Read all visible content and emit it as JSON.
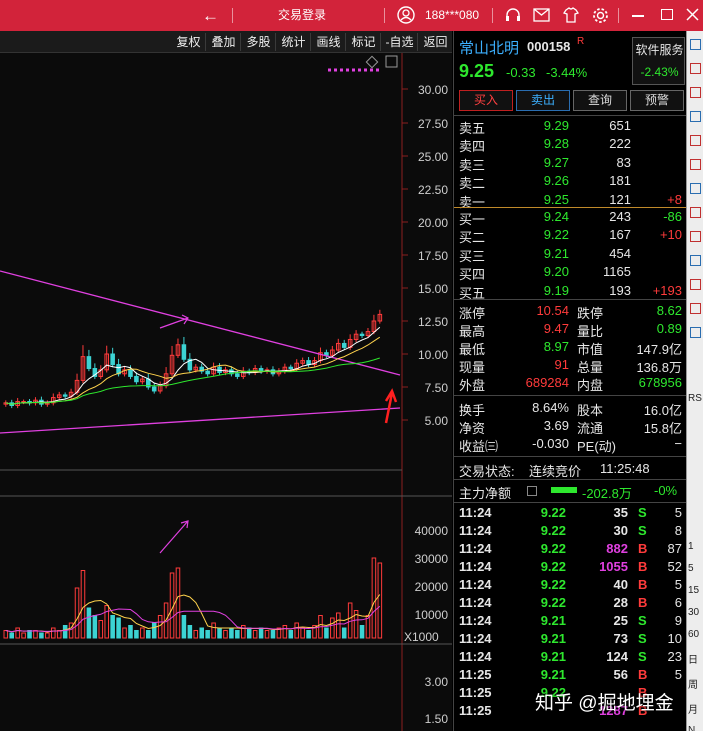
{
  "titlebar": {
    "back_arrow": "←",
    "title": "交易登录",
    "account": "188***080"
  },
  "toolbar": {
    "items": [
      "复权",
      "叠加",
      "多股",
      "统计",
      "画线",
      "标记",
      "-自选",
      "返回"
    ]
  },
  "chart": {
    "price_ticks": [
      "30.00",
      "27.50",
      "25.00",
      "22.50",
      "20.00",
      "17.50",
      "15.00",
      "12.50",
      "10.00",
      "7.50",
      "5.00"
    ],
    "volume_ticks": [
      "40000",
      "30000",
      "20000",
      "10000"
    ],
    "volume_unit": "X1000",
    "lower_ticks": [
      "3.00",
      "1.50"
    ],
    "colors": {
      "up": "#ff3b3b",
      "down": "#3cd3d3",
      "trend": "#e040e0",
      "ma_white": "#ffffff",
      "ma_yellow": "#ffd34d",
      "ma_green": "#2ee82e",
      "ma_magenta": "#e040e0"
    }
  },
  "stock": {
    "name": "常山北明",
    "code": "000158",
    "code_suffix": "R",
    "service_button": "软件服务",
    "service_change": "-2.43%",
    "price": "9.25",
    "change": "-0.33",
    "change_pct": "-3.44%"
  },
  "actions": [
    "买入",
    "卖出",
    "查询",
    "预警"
  ],
  "asks": [
    {
      "label": "卖五",
      "price": "9.29",
      "vol": "651",
      "delta": ""
    },
    {
      "label": "卖四",
      "price": "9.28",
      "vol": "222",
      "delta": ""
    },
    {
      "label": "卖三",
      "price": "9.27",
      "vol": "83",
      "delta": ""
    },
    {
      "label": "卖二",
      "price": "9.26",
      "vol": "181",
      "delta": ""
    },
    {
      "label": "卖一",
      "price": "9.25",
      "vol": "121",
      "delta": "+8"
    }
  ],
  "bids": [
    {
      "label": "买一",
      "price": "9.24",
      "vol": "243",
      "delta": "-86"
    },
    {
      "label": "买二",
      "price": "9.22",
      "vol": "167",
      "delta": "+10"
    },
    {
      "label": "买三",
      "price": "9.21",
      "vol": "454",
      "delta": ""
    },
    {
      "label": "买四",
      "price": "9.20",
      "vol": "1165",
      "delta": ""
    },
    {
      "label": "买五",
      "price": "9.19",
      "vol": "193",
      "delta": "+193"
    }
  ],
  "stats": {
    "zhangting_l": "涨停",
    "zhangting_v": "10.54",
    "dieting_l": "跌停",
    "dieting_v": "8.62",
    "zuigao_l": "最高",
    "zuigao_v": "9.47",
    "liangbi_l": "量比",
    "liangbi_v": "0.89",
    "zuidi_l": "最低",
    "zuidi_v": "8.97",
    "shizhi_l": "市值",
    "shizhi_v": "147.9亿",
    "xianliang_l": "现量",
    "xianliang_v": "91",
    "zongliang_l": "总量",
    "zongliang_v": "136.8万",
    "waipan_l": "外盘",
    "waipan_v": "689284",
    "neipan_l": "内盘",
    "neipan_v": "678956",
    "huanshou_l": "换手",
    "huanshou_v": "8.64%",
    "guben_l": "股本",
    "guben_v": "16.0亿",
    "jingzi_l": "净资",
    "jingzi_v": "3.69",
    "liutong_l": "流通",
    "liutong_v": "15.8亿",
    "shouyi_l": "收益㈢",
    "shouyi_v": "-0.030",
    "pe_l": "PE(动)",
    "pe_v": "−"
  },
  "trade_status": {
    "label": "交易状态:",
    "value": "连续竞价",
    "time": "11:25:48"
  },
  "net_flow": {
    "label": "主力净额",
    "value": "-202.8万",
    "pct": "-0%"
  },
  "ticks": [
    {
      "time": "11:24",
      "price": "9.22",
      "vol": "35",
      "side": "S",
      "n": "5"
    },
    {
      "time": "11:24",
      "price": "9.22",
      "vol": "30",
      "side": "S",
      "n": "8"
    },
    {
      "time": "11:24",
      "price": "9.22",
      "vol": "882",
      "side": "B",
      "n": "87"
    },
    {
      "time": "11:24",
      "price": "9.22",
      "vol": "1055",
      "side": "B",
      "n": "52"
    },
    {
      "time": "11:24",
      "price": "9.22",
      "vol": "40",
      "side": "B",
      "n": "5"
    },
    {
      "time": "11:24",
      "price": "9.22",
      "vol": "28",
      "side": "B",
      "n": "6"
    },
    {
      "time": "11:24",
      "price": "9.21",
      "vol": "25",
      "side": "S",
      "n": "9"
    },
    {
      "time": "11:24",
      "price": "9.21",
      "vol": "73",
      "side": "S",
      "n": "10"
    },
    {
      "time": "11:24",
      "price": "9.21",
      "vol": "124",
      "side": "S",
      "n": "23"
    },
    {
      "time": "11:25",
      "price": "9.21",
      "vol": "56",
      "side": "B",
      "n": "5"
    },
    {
      "time": "11:25",
      "price": "9.22",
      "vol": "",
      "side": "B",
      "n": ""
    },
    {
      "time": "11:25",
      "price": "",
      "vol": "1287",
      "side": "B",
      "n": ""
    }
  ],
  "right_strip": [
    "RS",
    "1",
    "5",
    "15",
    "30",
    "60",
    "日",
    "周",
    "月",
    "N"
  ],
  "watermark": "知乎 @掘地埋金"
}
